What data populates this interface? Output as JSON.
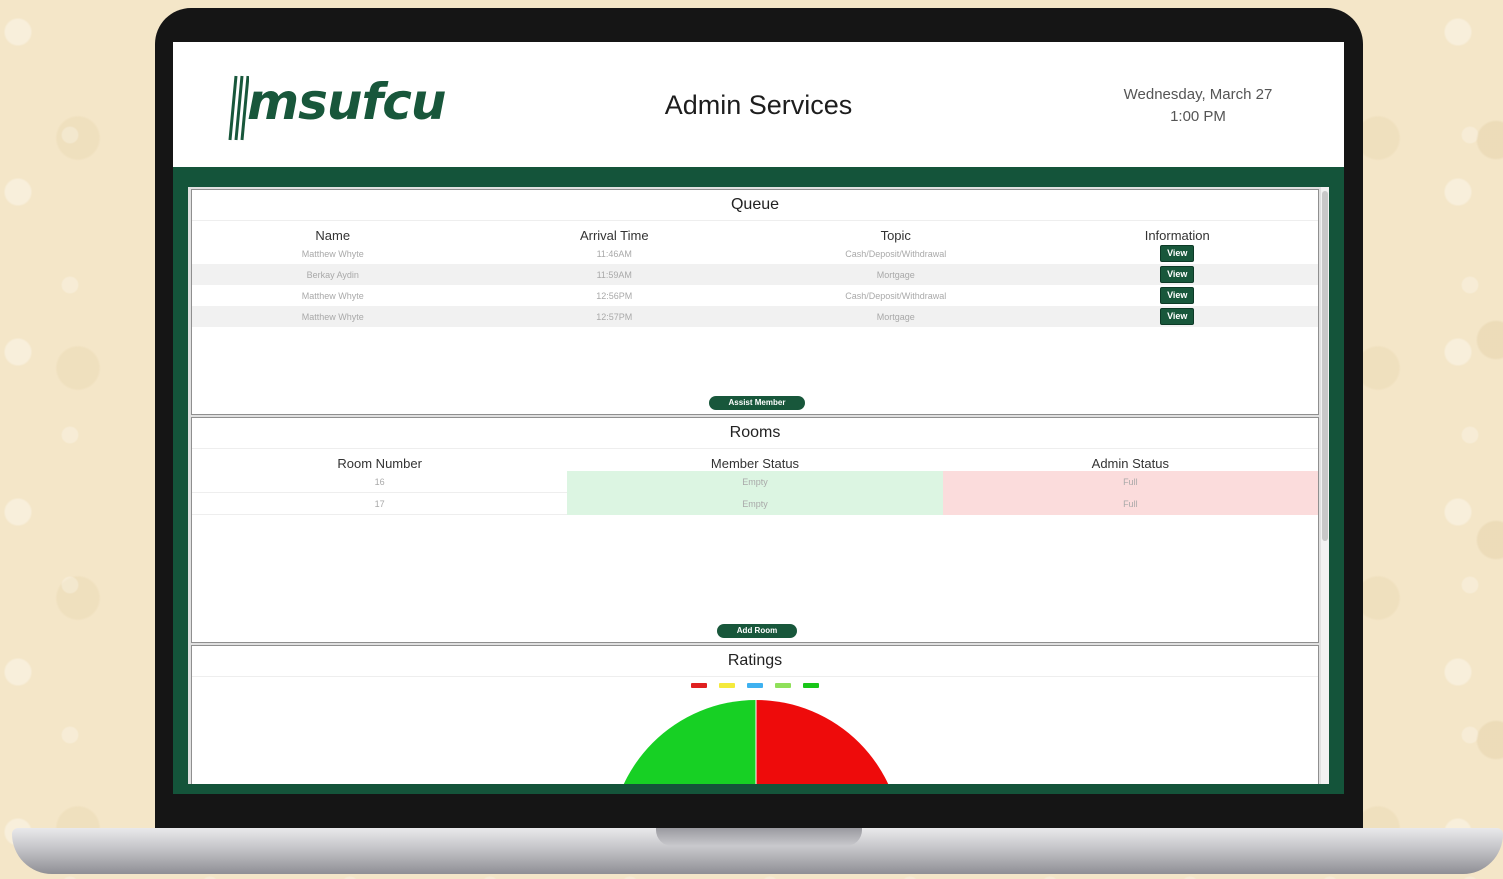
{
  "header": {
    "logo_text": "msufcu",
    "title": "Admin Services",
    "date": "Wednesday, March 27",
    "time": "1:00 PM"
  },
  "queue": {
    "title": "Queue",
    "columns": [
      "Name",
      "Arrival Time",
      "Topic",
      "Information"
    ],
    "rows": [
      {
        "name": "Matthew Whyte",
        "arrival": "11:46AM",
        "topic": "Cash/Deposit/Withdrawal",
        "action": "View"
      },
      {
        "name": "Berkay Aydin",
        "arrival": "11:59AM",
        "topic": "Mortgage",
        "action": "View"
      },
      {
        "name": "Matthew Whyte",
        "arrival": "12:56PM",
        "topic": "Cash/Deposit/Withdrawal",
        "action": "View"
      },
      {
        "name": "Matthew Whyte",
        "arrival": "12:57PM",
        "topic": "Mortgage",
        "action": "View"
      }
    ],
    "add_button": "Assist Member"
  },
  "rooms": {
    "title": "Rooms",
    "columns": [
      "Room Number",
      "Member Status",
      "Admin Status"
    ],
    "rows": [
      {
        "room": "16",
        "member_status": "Empty",
        "admin_status": "Full"
      },
      {
        "room": "17",
        "member_status": "Empty",
        "admin_status": "Full"
      }
    ],
    "add_button": "Add Room"
  },
  "ratings": {
    "title": "Ratings",
    "legend_colors": [
      "#e02020",
      "#f4ea3c",
      "#3fb1f0",
      "#8fe05a",
      "#19c619"
    ],
    "chart_slice_colors": [
      "#17d024",
      "#ee0b0b"
    ]
  },
  "colors": {
    "brand_green": "#18573b",
    "member_empty_bg": "#dcf5e2",
    "admin_full_bg": "#fbdcdc"
  }
}
